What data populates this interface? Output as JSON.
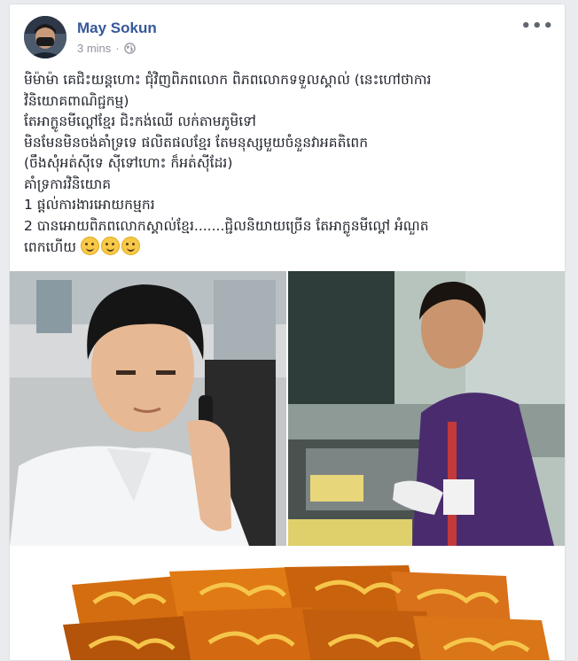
{
  "post": {
    "author": "May Sokun",
    "time": "3 mins",
    "more_label": "•••",
    "lines": [
      "មិម៉ាម៉ា គេជិះយន្តហោះ ជុំវិញពិភពលោក ពិភពលោកទទួលស្គាល់ (នេះហៅថាការ",
      "វិនិយោគពាណិជ្ជកម្ម)",
      "តែអាក្លូនមីល្ពៅខ្មែរ ជិះកង់ឈើ លក់តាមភូមិទៅ",
      "មិនមែនមិនចង់គាំទ្រទេ ផលិតផលខ្មែរ តែមនុស្សមួយចំនួនវាអគតិពេក",
      "(ចឹងសុំអត់ស៊ីទេ ស៊ីទៅហោះ ក៏អត់ស៊ីដែរ)",
      "គាំទ្រការវិនិយោគ",
      "1 ផ្តល់ការងារអោយកម្មករ",
      "2 បានអោយពិភពលោកស្គាល់ខ្មែរ.......ជ្ជិលនិយាយច្រើន តែអាក្លូនមីល្ពៅ អំណួត"
    ],
    "last_line": "ពេកហើយ",
    "emoji": [
      "smirk-emoji",
      "smirk-emoji",
      "smirk-emoji"
    ]
  },
  "photos": {
    "left": "man-on-phone-photo",
    "right": "boy-preparing-snacks-photo",
    "bottom": "snack-packages-photo"
  },
  "colors": {
    "author": "#365899",
    "meta": "#90949c",
    "text": "#1d2129",
    "background": "#e9ebee"
  }
}
